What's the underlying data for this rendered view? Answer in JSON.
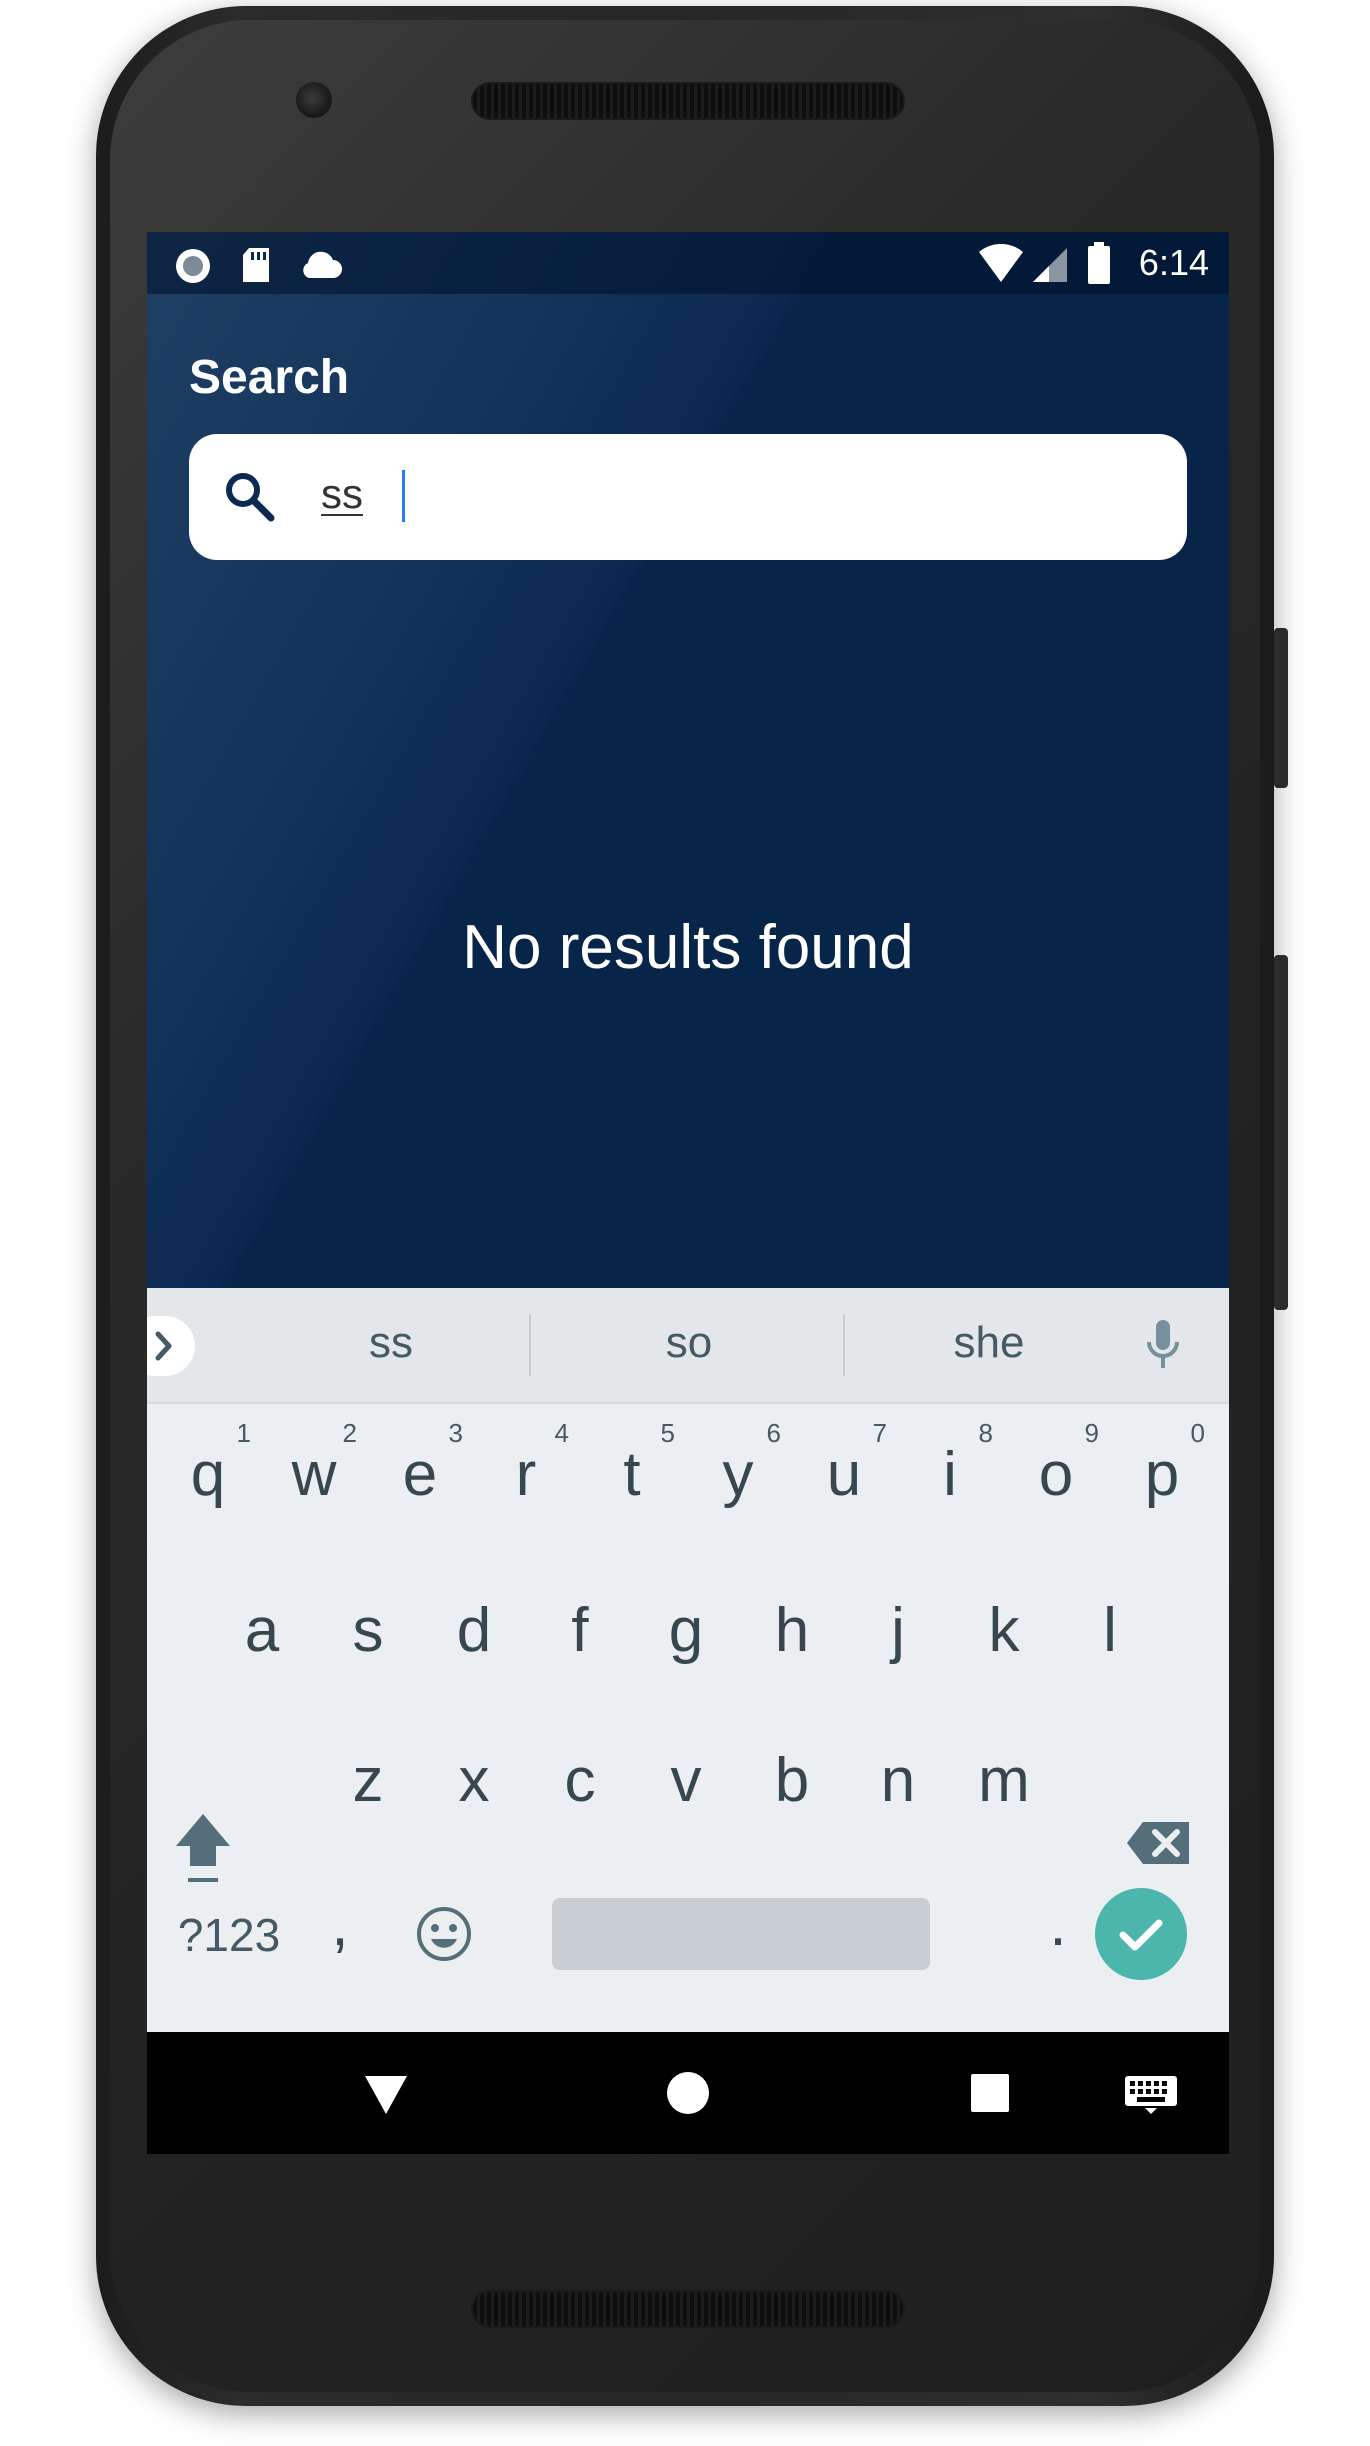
{
  "status_bar": {
    "time": "6:14",
    "left_icons": [
      "record-icon",
      "sd-card-icon",
      "cloud-icon"
    ],
    "right_icons": [
      "wifi-icon",
      "signal-icon",
      "battery-icon"
    ]
  },
  "header": {
    "title": "Search"
  },
  "search": {
    "value": "ss",
    "icon": "search-icon"
  },
  "main": {
    "empty_message": "No results found"
  },
  "keyboard": {
    "suggestions": [
      "ss",
      "so",
      "she"
    ],
    "row1": [
      {
        "key": "q",
        "hint": "1"
      },
      {
        "key": "w",
        "hint": "2"
      },
      {
        "key": "e",
        "hint": "3"
      },
      {
        "key": "r",
        "hint": "4"
      },
      {
        "key": "t",
        "hint": "5"
      },
      {
        "key": "y",
        "hint": "6"
      },
      {
        "key": "u",
        "hint": "7"
      },
      {
        "key": "i",
        "hint": "8"
      },
      {
        "key": "o",
        "hint": "9"
      },
      {
        "key": "p",
        "hint": "0"
      }
    ],
    "row2": [
      "a",
      "s",
      "d",
      "f",
      "g",
      "h",
      "j",
      "k",
      "l"
    ],
    "row3": [
      "z",
      "x",
      "c",
      "v",
      "b",
      "n",
      "m"
    ],
    "symbols_label": "?123",
    "comma": ",",
    "period": ".",
    "enter_color": "#4db6ac"
  },
  "colors": {
    "app_background": "#072449",
    "keyboard_background": "#eceff1",
    "key_text": "#37474f"
  }
}
